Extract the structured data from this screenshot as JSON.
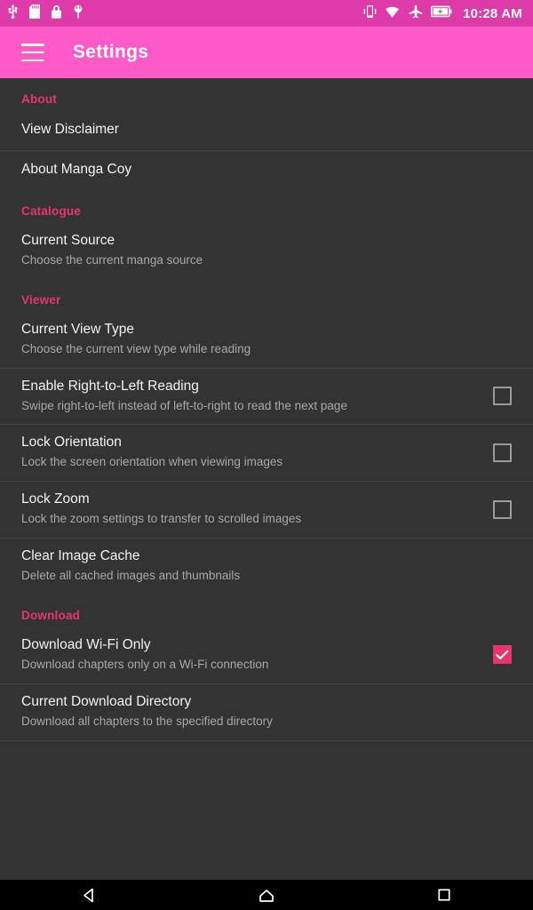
{
  "status_bar": {
    "left_icons": [
      "usb-icon",
      "sd-card-icon",
      "lock-icon",
      "gps-icon"
    ],
    "right_icons": [
      "vibrate-icon",
      "wifi-icon",
      "airplane-mode-icon",
      "battery-charging-icon"
    ],
    "clock": "10:28 AM",
    "background_color": "#DD3BA8"
  },
  "app_bar": {
    "menu_icon": "hamburger-menu-icon",
    "title": "Settings",
    "background_color": "#FF5BC8"
  },
  "colors": {
    "accent": "#E8356D",
    "content_background": "#333333",
    "divider": "#444444",
    "title_text": "#F2F2F2",
    "summary_text": "#A8A8A8"
  },
  "sections": [
    {
      "header": "About",
      "items": [
        {
          "title": "View Disclaimer",
          "summary": "",
          "control": "none"
        },
        {
          "title": "About Manga Coy",
          "summary": "",
          "control": "none"
        }
      ]
    },
    {
      "header": "Catalogue",
      "items": [
        {
          "title": "Current Source",
          "summary": "Choose the current manga source",
          "control": "none"
        }
      ]
    },
    {
      "header": "Viewer",
      "items": [
        {
          "title": "Current View Type",
          "summary": "Choose the current view type while reading",
          "control": "none"
        },
        {
          "title": "Enable Right-to-Left Reading",
          "summary": "Swipe right-to-left instead of left-to-right to read the next page",
          "control": "checkbox",
          "checked": false
        },
        {
          "title": "Lock Orientation",
          "summary": "Lock the screen orientation when viewing images",
          "control": "checkbox",
          "checked": false
        },
        {
          "title": "Lock Zoom",
          "summary": "Lock the zoom settings to transfer to scrolled images",
          "control": "checkbox",
          "checked": false
        },
        {
          "title": "Clear Image Cache",
          "summary": "Delete all cached images and thumbnails",
          "control": "none"
        }
      ]
    },
    {
      "header": "Download",
      "items": [
        {
          "title": "Download Wi-Fi Only",
          "summary": "Download chapters only on a Wi-Fi connection",
          "control": "checkbox",
          "checked": true
        },
        {
          "title": "Current Download Directory",
          "summary": "Download all chapters to the specified directory",
          "control": "none"
        }
      ]
    }
  ],
  "nav_bar": {
    "buttons": [
      {
        "name": "back-button",
        "icon": "back-triangle-icon"
      },
      {
        "name": "home-button",
        "icon": "home-icon"
      },
      {
        "name": "recents-button",
        "icon": "recents-square-icon"
      }
    ]
  }
}
